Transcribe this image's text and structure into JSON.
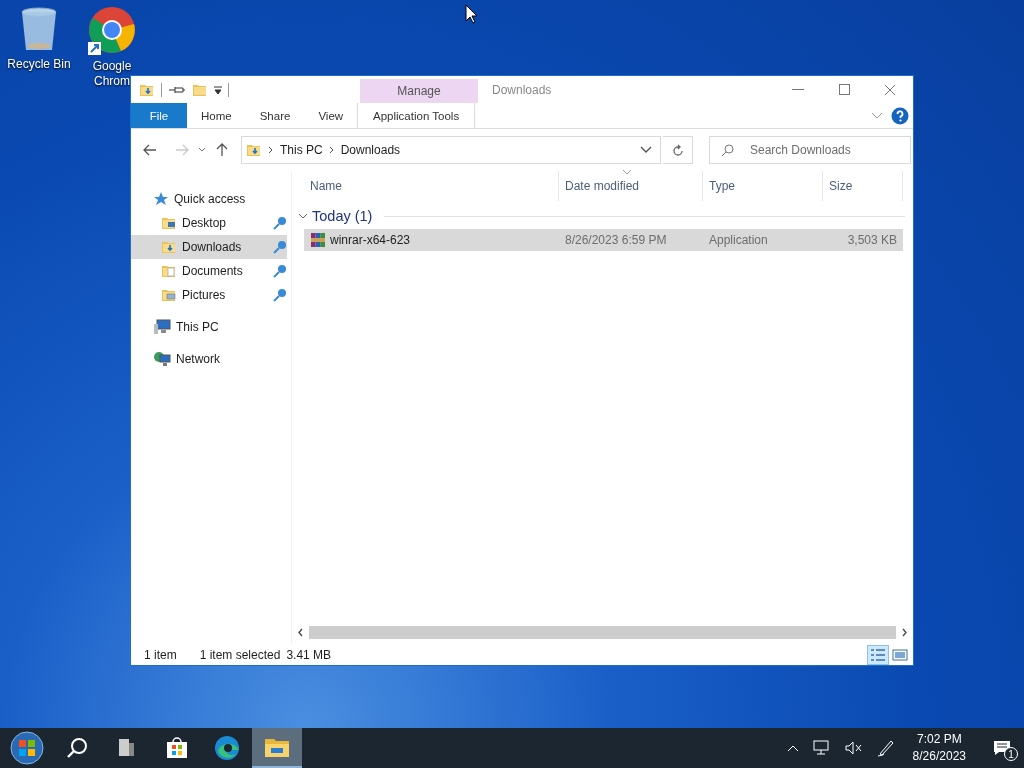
{
  "desktop_icons": [
    {
      "label": "Recycle Bin",
      "kind": "recycle"
    },
    {
      "label": "Google Chrom",
      "kind": "chrome"
    }
  ],
  "window": {
    "title": "Downloads",
    "context_group": "Manage",
    "ribbon_tabs": [
      {
        "label": "File",
        "kind": "file",
        "selected": false
      },
      {
        "label": "Home",
        "kind": "normal",
        "selected": false
      },
      {
        "label": "Share",
        "kind": "normal",
        "selected": false
      },
      {
        "label": "View",
        "kind": "normal",
        "selected": false
      },
      {
        "label": "Application Tools",
        "kind": "context",
        "selected": false
      }
    ],
    "address": {
      "path": [
        "This PC",
        "Downloads"
      ]
    },
    "search": {
      "placeholder": "Search Downloads"
    },
    "nav_items": [
      {
        "label": "Quick access",
        "kind": "star",
        "selected": false,
        "pinned": false,
        "children": [
          {
            "label": "Desktop",
            "kind": "desktop",
            "selected": false,
            "pinned": true
          },
          {
            "label": "Downloads",
            "kind": "downloads",
            "selected": true,
            "pinned": true
          },
          {
            "label": "Documents",
            "kind": "documents",
            "selected": false,
            "pinned": true
          },
          {
            "label": "Pictures",
            "kind": "pictures",
            "selected": false,
            "pinned": true
          }
        ]
      },
      {
        "label": "This PC",
        "kind": "pc",
        "selected": false,
        "pinned": false
      },
      {
        "label": "Network",
        "kind": "network",
        "selected": false,
        "pinned": false
      }
    ],
    "columns": [
      {
        "label": "Name",
        "sorted": false
      },
      {
        "label": "Date modified",
        "sorted": true
      },
      {
        "label": "Type",
        "sorted": false
      },
      {
        "label": "Size",
        "sorted": false
      }
    ],
    "groups": [
      {
        "label": "Today (1)",
        "expanded": true,
        "rows": [
          {
            "name": "winrar-x64-623",
            "date": "8/26/2023 6:59 PM",
            "type": "Application",
            "size": "3,503 KB",
            "selected": true
          }
        ]
      }
    ],
    "status": {
      "count": "1 item",
      "selection": "1 item selected",
      "size": "3.41 MB"
    },
    "view_buttons": [
      {
        "kind": "details",
        "selected": true
      },
      {
        "kind": "tiles",
        "selected": false
      }
    ]
  },
  "taskbar": {
    "apps": [
      {
        "kind": "start",
        "selected": false
      },
      {
        "kind": "search",
        "selected": false
      },
      {
        "kind": "taskview",
        "selected": false
      },
      {
        "kind": "store",
        "selected": false
      },
      {
        "kind": "edge",
        "selected": false
      },
      {
        "kind": "explorer",
        "selected": true
      }
    ],
    "time": "7:02 PM",
    "date": "8/26/2023",
    "notifications": "1"
  }
}
